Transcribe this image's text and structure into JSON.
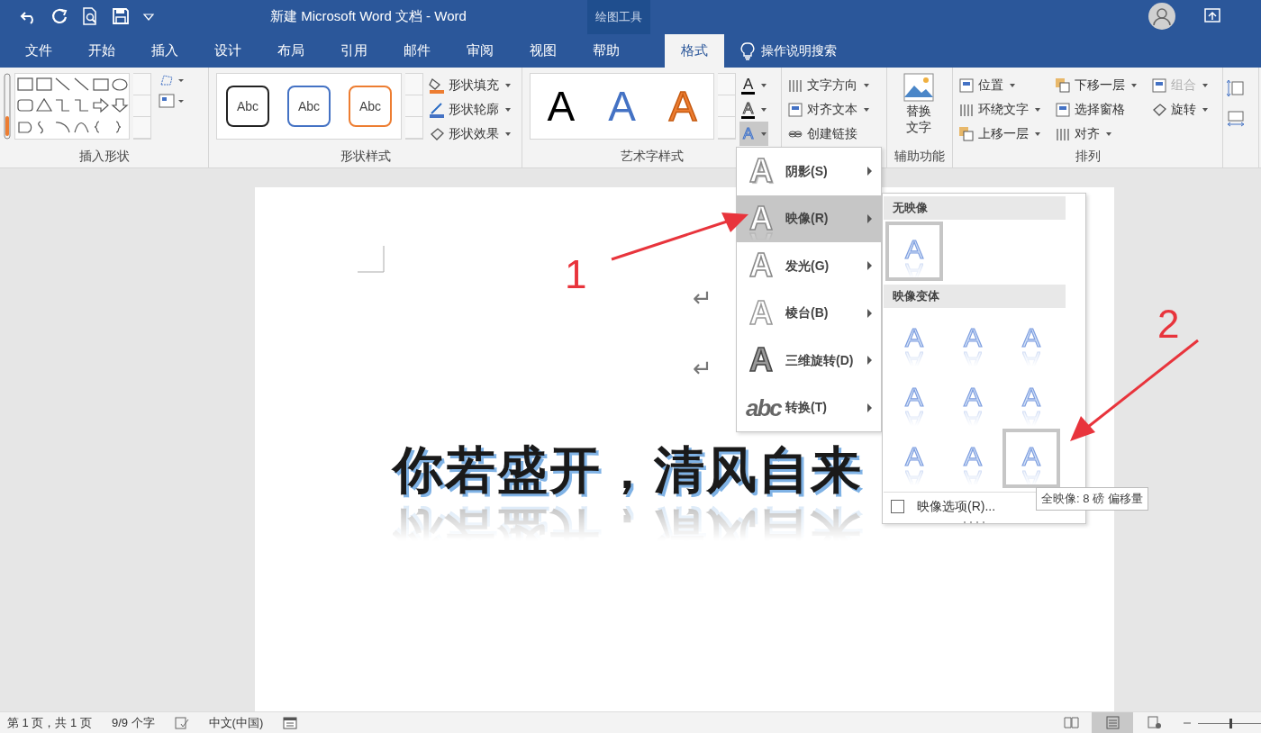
{
  "title_bar": {
    "title": "新建 Microsoft Word 文档  -  Word",
    "context_label": "绘图工具"
  },
  "tabs": [
    {
      "label": "文件",
      "selected": false
    },
    {
      "label": "开始",
      "selected": false
    },
    {
      "label": "插入",
      "selected": false
    },
    {
      "label": "设计",
      "selected": false
    },
    {
      "label": "布局",
      "selected": false
    },
    {
      "label": "引用",
      "selected": false
    },
    {
      "label": "邮件",
      "selected": false
    },
    {
      "label": "审阅",
      "selected": false
    },
    {
      "label": "视图",
      "selected": false
    },
    {
      "label": "帮助",
      "selected": false
    },
    {
      "label": "格式",
      "selected": true
    }
  ],
  "tell_me": {
    "label": "操作说明搜索"
  },
  "insert_shapes": {
    "label": "插入形状"
  },
  "shape_styles": {
    "label": "形状样式",
    "presets": [
      {
        "text": "Abc",
        "color": "#222222"
      },
      {
        "text": "Abc",
        "color": "#4472c4"
      },
      {
        "text": "Abc",
        "color": "#ed7d31"
      }
    ],
    "commands": [
      {
        "label": "形状填充",
        "dropdown": true
      },
      {
        "label": "形状轮廓",
        "dropdown": true
      },
      {
        "label": "形状效果",
        "dropdown": true
      }
    ]
  },
  "wordart_styles": {
    "label": "艺术字样式",
    "presets": [
      {
        "text": "A",
        "kind": "solid",
        "color": "#000000"
      },
      {
        "text": "A",
        "kind": "solid",
        "color": "#4472c4"
      },
      {
        "text": "A",
        "kind": "outline",
        "color": "#ed7d31"
      }
    ],
    "tools": [
      {
        "glyph": "A",
        "kind": "fill",
        "selected": false
      },
      {
        "glyph": "A",
        "kind": "outline",
        "selected": false
      },
      {
        "glyph": "A",
        "kind": "effects",
        "selected": true
      }
    ]
  },
  "text_group": {
    "commands": [
      {
        "label": "文字方向",
        "dropdown": true
      },
      {
        "label": "对齐文本",
        "dropdown": true
      },
      {
        "label": "创建链接",
        "dropdown": false
      }
    ]
  },
  "accessibility": {
    "label": "辅助功能",
    "button": "替换文字"
  },
  "arrange": {
    "label": "排列",
    "columns": [
      [
        {
          "label": "位置",
          "dropdown": true,
          "disabled": false
        },
        {
          "label": "环绕文字",
          "dropdown": true,
          "disabled": false
        },
        {
          "label": "上移一层",
          "dropdown": true,
          "disabled": false
        }
      ],
      [
        {
          "label": "下移一层",
          "dropdown": true,
          "disabled": false
        },
        {
          "label": "选择窗格",
          "dropdown": false,
          "disabled": false
        },
        {
          "label": "对齐",
          "dropdown": true,
          "disabled": false
        }
      ],
      [
        {
          "label": "组合",
          "dropdown": true,
          "disabled": true
        },
        {
          "label": "旋转",
          "dropdown": true,
          "disabled": false
        }
      ]
    ]
  },
  "document": {
    "marks": [
      "↵",
      "↵"
    ],
    "heading": "你若盛开，清风自来"
  },
  "annotations": [
    {
      "text": "1"
    },
    {
      "text": "2"
    }
  ],
  "effects_menu": {
    "items": [
      {
        "glyph": "A",
        "kind": "shadow",
        "label": "阴影(S)",
        "selected": false
      },
      {
        "glyph": "A",
        "kind": "reflection",
        "label": "映像(R)",
        "selected": true
      },
      {
        "glyph": "A",
        "kind": "glow",
        "label": "发光(G)",
        "selected": false
      },
      {
        "glyph": "A",
        "kind": "bevel",
        "label": "棱台(B)",
        "selected": false
      },
      {
        "glyph": "A",
        "kind": "rotation",
        "label": "三维旋转(D)",
        "selected": false
      },
      {
        "glyph": "abc",
        "kind": "transform",
        "label": "转换(T)",
        "selected": false
      }
    ]
  },
  "reflection_submenu": {
    "sections": [
      {
        "title": "无映像",
        "options": [
          {
            "glyph": "A",
            "selected": true
          }
        ]
      },
      {
        "title": "映像变体",
        "options": [
          {
            "glyph": "A",
            "selected": false
          },
          {
            "glyph": "A",
            "selected": false
          },
          {
            "glyph": "A",
            "selected": false
          },
          {
            "glyph": "A",
            "selected": false
          },
          {
            "glyph": "A",
            "selected": false
          },
          {
            "glyph": "A",
            "selected": false
          },
          {
            "glyph": "A",
            "selected": false
          },
          {
            "glyph": "A",
            "selected": false
          },
          {
            "glyph": "A",
            "selected": true
          }
        ]
      }
    ],
    "footer": {
      "label": "映像选项(R)...",
      "checked": false
    },
    "tooltip": "全映像: 8 磅 偏移量"
  },
  "status_bar": {
    "items": [
      "第 1 页，共 1 页",
      "9/9 个字",
      "中文(中国)"
    ],
    "views": [
      {
        "selected": false
      },
      {
        "selected": true
      },
      {
        "selected": false
      }
    ],
    "zoom_slider": {
      "level": 0.5
    }
  }
}
